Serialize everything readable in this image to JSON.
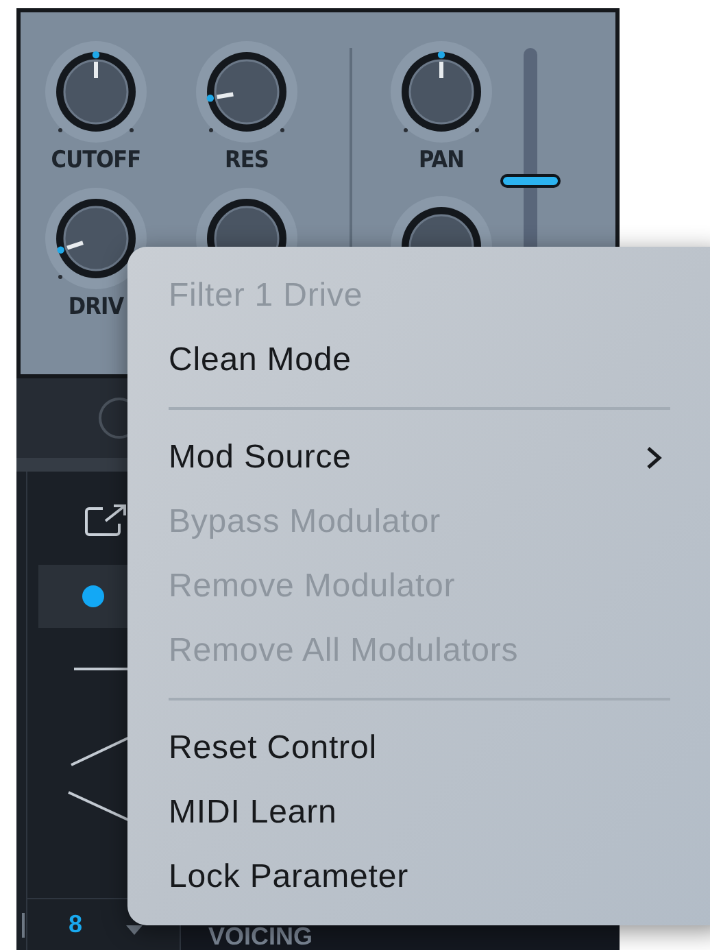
{
  "synth": {
    "knobs": [
      {
        "label": "CUTOFF",
        "level": 0.5
      },
      {
        "label": "RES",
        "level": 0.13
      },
      {
        "label": "PAN",
        "level": 0.5
      },
      {
        "label": "DRIV",
        "level": 0.1
      }
    ],
    "fader": {
      "level": 0.6
    },
    "voice_count": "8",
    "section_title": "VOICING"
  },
  "context_menu": {
    "items": [
      {
        "kind": "item",
        "label": "Filter 1 Drive",
        "disabled": true
      },
      {
        "kind": "item",
        "label": "Clean Mode",
        "disabled": false
      },
      {
        "kind": "separator"
      },
      {
        "kind": "submenu",
        "label": "Mod Source",
        "disabled": false
      },
      {
        "kind": "item",
        "label": "Bypass Modulator",
        "disabled": true
      },
      {
        "kind": "item",
        "label": "Remove Modulator",
        "disabled": true
      },
      {
        "kind": "item",
        "label": "Remove All Modulators",
        "disabled": true
      },
      {
        "kind": "separator"
      },
      {
        "kind": "item",
        "label": "Reset Control",
        "disabled": false
      },
      {
        "kind": "item",
        "label": "MIDI Learn",
        "disabled": false
      },
      {
        "kind": "item",
        "label": "Lock Parameter",
        "disabled": false
      }
    ]
  }
}
